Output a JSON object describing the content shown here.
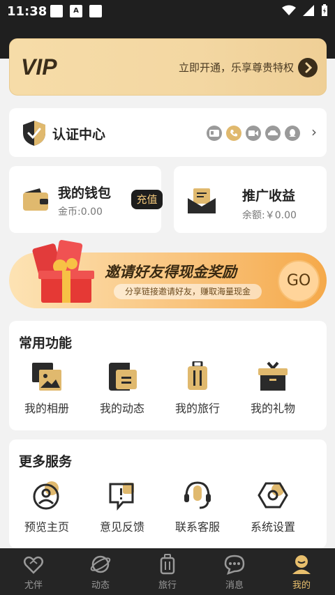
{
  "status_bar": {
    "time": "11:38"
  },
  "vip": {
    "logo_text": "VIP",
    "promo": "立即开通，乐享尊贵特权"
  },
  "auth_center": {
    "title": "认证中心"
  },
  "wallet": {
    "title": "我的钱包",
    "balance": "金币:0.00",
    "recharge": "充值"
  },
  "earnings": {
    "title": "推广收益",
    "balance": "余额:￥0.00"
  },
  "invite_banner": {
    "headline": "邀请好友得现金奖励",
    "subline": "分享链接邀请好友，赚取海量现金",
    "go": "GO"
  },
  "common_functions": {
    "title": "常用功能",
    "items": [
      {
        "label": "我的相册",
        "icon": "album-icon"
      },
      {
        "label": "我的动态",
        "icon": "moments-icon"
      },
      {
        "label": "我的旅行",
        "icon": "luggage-icon"
      },
      {
        "label": "我的礼物",
        "icon": "gift-box-icon"
      }
    ]
  },
  "more_services": {
    "title": "更多服务",
    "items": [
      {
        "label": "预览主页",
        "icon": "profile-icon"
      },
      {
        "label": "意见反馈",
        "icon": "feedback-icon"
      },
      {
        "label": "联系客服",
        "icon": "headset-icon"
      },
      {
        "label": "系统设置",
        "icon": "settings-icon"
      }
    ]
  },
  "tabs": [
    {
      "label": "尤伴",
      "icon": "heart-hands-icon",
      "active": false
    },
    {
      "label": "动态",
      "icon": "planet-icon",
      "active": false
    },
    {
      "label": "旅行",
      "icon": "suitcase-icon",
      "active": false
    },
    {
      "label": "消息",
      "icon": "chat-icon",
      "active": false
    },
    {
      "label": "我的",
      "icon": "user-icon",
      "active": true
    }
  ],
  "colors": {
    "accent": "#e0b96e",
    "dark": "#1f1f1f",
    "tab_active": "#e8bf6d"
  }
}
